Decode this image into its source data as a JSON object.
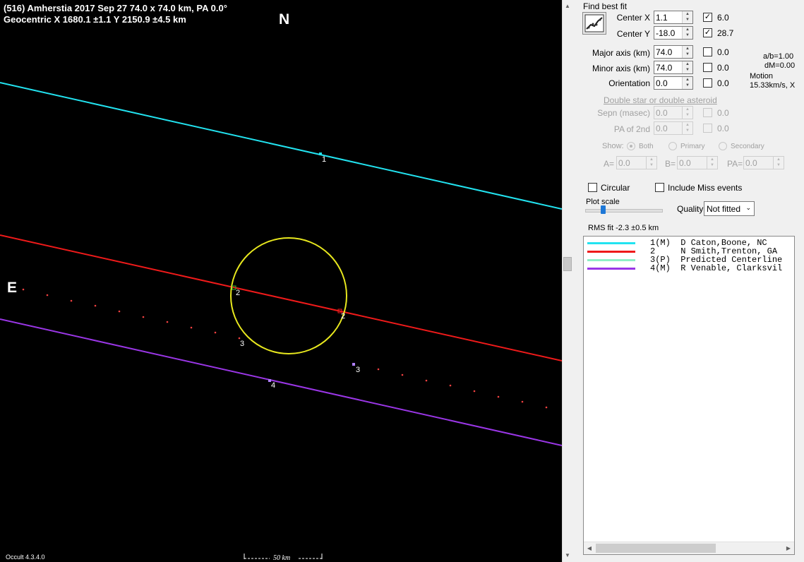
{
  "plot": {
    "title_line1": "(516) Amherstia  2017 Sep 27  74.0 x 74.0 km, PA 0.0°",
    "title_line2": "Geocentric  X  1680.1 ±1.1  Y 2150.9 ±4.5 km",
    "north_label": "N",
    "east_label": "E",
    "chord_numbers": [
      "1",
      "2",
      "2",
      "3",
      "3",
      "4"
    ],
    "scale_label": "50 km",
    "version": "Occult 4.3.4.0",
    "colors": {
      "background": "#000000",
      "chord1": "#22e3f0",
      "chord2": "#ef1a1a",
      "chord4": "#9a36e6",
      "ellipse": "#e8e81e",
      "predicted": "#f04040"
    }
  },
  "panel": {
    "find_best_fit": "Find best fit",
    "center_x_label": "Center X",
    "center_x_value": "1.1",
    "center_x_check": "6.0",
    "center_y_label": "Center Y",
    "center_y_value": "-18.0",
    "center_y_check": "28.7",
    "major_label": "Major axis (km)",
    "major_value": "74.0",
    "major_check": "0.0",
    "minor_label": "Minor axis (km)",
    "minor_value": "74.0",
    "minor_check": "0.0",
    "orient_label": "Orientation",
    "orient_value": "0.0",
    "orient_check": "0.0",
    "ab_text": "a/b=1.00",
    "dm_text": "dM=0.00",
    "motion_label": "Motion",
    "motion_value": "15.33km/s, X",
    "double_header": "Double star  or  double asteroid",
    "sepn_label": "Sepn (masec)",
    "sepn_value": "0.0",
    "sepn_check": "0.0",
    "pa2_label": "PA of 2nd",
    "pa2_value": "0.0",
    "pa2_check": "0.0",
    "show_label": "Show:",
    "show_both": "Both",
    "show_primary": "Primary",
    "show_secondary": "Secondary",
    "a_label": "A=",
    "a_value": "0.0",
    "b_label": "B=",
    "b_value": "0.0",
    "pa_label": "PA=",
    "pa_value": "0.0",
    "circular_label": "Circular",
    "miss_label": "Include Miss events",
    "plot_scale_label": "Plot scale",
    "quality_label": "Quality",
    "quality_value": "Not fitted",
    "rms_text": "RMS fit -2.3 ±0.5 km",
    "legend": [
      {
        "text": "1(M)  D Caton,Boone, NC",
        "color": "#22e3f0"
      },
      {
        "text": "2     N Smith,Trenton, GA",
        "color": "#ef1a1a"
      },
      {
        "text": "3(P)  Predicted Centerline",
        "color": "#8ef0c6"
      },
      {
        "text": "4(M)  R Venable, Clarksvil",
        "color": "#9a36e6"
      }
    ]
  }
}
